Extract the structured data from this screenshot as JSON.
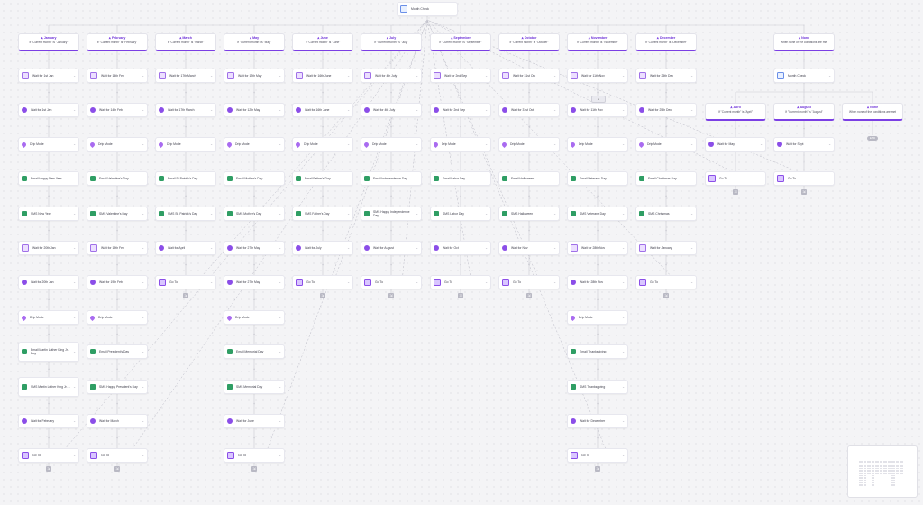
{
  "top_node": {
    "label": "Month Check",
    "icon": "code-icon"
  },
  "columns": [
    {
      "id": "january",
      "title": "January",
      "condition": "If \"Current month\" is \"January\"",
      "steps": [
        {
          "type": "wait-date",
          "label": "Wait for 1st Jan"
        },
        {
          "type": "wait-time",
          "label": "Wait for 1st Jan"
        },
        {
          "type": "drip",
          "label": "Drip Mode"
        },
        {
          "type": "email",
          "label": "Email Happy New Year"
        },
        {
          "type": "sms",
          "label": "SMS New Year"
        },
        {
          "type": "wait-date",
          "label": "Wait for 20th Jan"
        },
        {
          "type": "wait-time",
          "label": "Wait for 20th Jan"
        },
        {
          "type": "drip",
          "label": "Drip Mode"
        },
        {
          "type": "email",
          "label": "Email Martin Luther King Jr. Day"
        },
        {
          "type": "sms",
          "label": "SMS Martin Luther King Jr. ..."
        },
        {
          "type": "wait-time",
          "label": "Wait for February"
        },
        {
          "type": "goto",
          "label": "Go To"
        }
      ]
    },
    {
      "id": "february",
      "title": "February",
      "condition": "If \"Current month\" is \"February\"",
      "steps": [
        {
          "type": "wait-date",
          "label": "Wait for 14th Feb"
        },
        {
          "type": "wait-time",
          "label": "Wait for 14th Feb"
        },
        {
          "type": "drip",
          "label": "Drip Mode"
        },
        {
          "type": "email",
          "label": "Email Valentine's Day"
        },
        {
          "type": "sms",
          "label": "SMS Valentine's Day"
        },
        {
          "type": "wait-date",
          "label": "Wait for 19th Feb"
        },
        {
          "type": "wait-time",
          "label": "Wait for 19th Feb"
        },
        {
          "type": "drip",
          "label": "Drip Mode"
        },
        {
          "type": "email",
          "label": "Email President's Day"
        },
        {
          "type": "sms",
          "label": "SMS Happy President's Day"
        },
        {
          "type": "wait-time",
          "label": "Wait for March"
        },
        {
          "type": "goto",
          "label": "Go To"
        }
      ]
    },
    {
      "id": "march",
      "title": "March",
      "condition": "If \"Current month\" is \"March\"",
      "steps": [
        {
          "type": "wait-date",
          "label": "Wait for 17th March"
        },
        {
          "type": "wait-time",
          "label": "Wait for 17th March"
        },
        {
          "type": "drip",
          "label": "Drip Mode"
        },
        {
          "type": "email",
          "label": "Email St Patrick's Day"
        },
        {
          "type": "sms",
          "label": "SMS St. Patrick's Day"
        },
        {
          "type": "wait-time",
          "label": "Wait for April"
        },
        {
          "type": "goto",
          "label": "Go To"
        }
      ]
    },
    {
      "id": "may",
      "title": "May",
      "condition": "If \"Current month\" is \"May\"",
      "steps": [
        {
          "type": "wait-date",
          "label": "Wait for 12th May"
        },
        {
          "type": "wait-time",
          "label": "Wait for 12th May"
        },
        {
          "type": "drip",
          "label": "Drip Mode"
        },
        {
          "type": "email",
          "label": "Email Mother's Day"
        },
        {
          "type": "sms",
          "label": "SMS Mother's Day"
        },
        {
          "type": "wait-time",
          "label": "Wait for 27th May"
        },
        {
          "type": "wait-time",
          "label": "Wait for 27th May"
        },
        {
          "type": "drip",
          "label": "Drip Mode"
        },
        {
          "type": "email",
          "label": "Email Memorial Day"
        },
        {
          "type": "sms",
          "label": "SMS Memorial Day"
        },
        {
          "type": "wait-time",
          "label": "Wait for June"
        },
        {
          "type": "goto",
          "label": "Go To"
        }
      ]
    },
    {
      "id": "june",
      "title": "June",
      "condition": "If \"Current month\" is \"June\"",
      "steps": [
        {
          "type": "wait-date",
          "label": "Wait for 16th June"
        },
        {
          "type": "wait-time",
          "label": "Wait for 16th June"
        },
        {
          "type": "drip",
          "label": "Drip Mode"
        },
        {
          "type": "email",
          "label": "Email Father's Day"
        },
        {
          "type": "sms",
          "label": "SMS Father's Day"
        },
        {
          "type": "wait-time",
          "label": "Wait for July"
        },
        {
          "type": "goto",
          "label": "Go To"
        }
      ]
    },
    {
      "id": "july",
      "title": "July",
      "condition": "If \"Current month\" is \"July\"",
      "steps": [
        {
          "type": "wait-date",
          "label": "Wait for 4th July"
        },
        {
          "type": "wait-time",
          "label": "Wait for 4th July"
        },
        {
          "type": "drip",
          "label": "Drip Mode"
        },
        {
          "type": "email",
          "label": "Email Independence Day"
        },
        {
          "type": "sms",
          "label": "SMS Happy Independence Day"
        },
        {
          "type": "wait-time",
          "label": "Wait for August"
        },
        {
          "type": "goto",
          "label": "Go To"
        }
      ]
    },
    {
      "id": "september",
      "title": "September",
      "condition": "If \"Current month\" is \"September\"",
      "steps": [
        {
          "type": "wait-date",
          "label": "Wait for 2nd Sep"
        },
        {
          "type": "wait-time",
          "label": "Wait for 2nd Sep"
        },
        {
          "type": "drip",
          "label": "Drip Mode"
        },
        {
          "type": "email",
          "label": "Email Labor Day"
        },
        {
          "type": "sms",
          "label": "SMS Labor Day"
        },
        {
          "type": "wait-time",
          "label": "Wait for Oct"
        },
        {
          "type": "goto",
          "label": "Go To"
        }
      ]
    },
    {
      "id": "october",
      "title": "October",
      "condition": "If \"Current month\" is \"October\"",
      "steps": [
        {
          "type": "wait-date",
          "label": "Wait for 31st Oct"
        },
        {
          "type": "wait-time",
          "label": "Wait for 31st Oct"
        },
        {
          "type": "drip",
          "label": "Drip Mode"
        },
        {
          "type": "email",
          "label": "Email Halloween"
        },
        {
          "type": "sms",
          "label": "SMS Halloween"
        },
        {
          "type": "wait-time",
          "label": "Wait for Nov"
        },
        {
          "type": "goto",
          "label": "Go To"
        }
      ]
    },
    {
      "id": "november",
      "title": "November",
      "condition": "If \"Current month\" is \"November\"",
      "steps": [
        {
          "type": "wait-date",
          "label": "Wait for 11th Nov"
        },
        {
          "type": "wait-time",
          "label": "Wait for 11th Nov"
        },
        {
          "type": "drip",
          "label": "Drip Mode"
        },
        {
          "type": "email",
          "label": "Email Veterans Day"
        },
        {
          "type": "sms",
          "label": "SMS Veterans Day"
        },
        {
          "type": "wait-date",
          "label": "Wait for 28th Nov"
        },
        {
          "type": "wait-time",
          "label": "Wait for 28th Nov"
        },
        {
          "type": "drip",
          "label": "Drip Mode"
        },
        {
          "type": "email",
          "label": "Email Thanksgiving"
        },
        {
          "type": "sms",
          "label": "SMS Thanksgiving"
        },
        {
          "type": "wait-time",
          "label": "Wait for December"
        },
        {
          "type": "goto",
          "label": "Go To"
        }
      ]
    },
    {
      "id": "december",
      "title": "December",
      "condition": "If \"Current month\" is \"December\"",
      "steps": [
        {
          "type": "wait-date",
          "label": "Wait for 25th Dec"
        },
        {
          "type": "wait-time",
          "label": "Wait for 25th Dec"
        },
        {
          "type": "drip",
          "label": "Drip Mode"
        },
        {
          "type": "email",
          "label": "Email Christmas Day"
        },
        {
          "type": "sms",
          "label": "SMS Christmas"
        },
        {
          "type": "wait-date",
          "label": "Wait for January"
        },
        {
          "type": "goto",
          "label": "Go To"
        }
      ]
    },
    {
      "id": "none",
      "title": "None",
      "condition": "When none of the conditions are met",
      "steps": [
        {
          "type": "code",
          "label": "Month Check"
        }
      ]
    }
  ],
  "sub_branches": [
    {
      "id": "april",
      "title": "April",
      "condition": "If \"Current month\" is \"April\"",
      "steps": [
        {
          "type": "wait-time",
          "label": "Wait for May"
        },
        {
          "type": "goto",
          "label": "Go To"
        }
      ]
    },
    {
      "id": "august",
      "title": "August",
      "condition": "If \"Current month\" is \"August\"",
      "steps": [
        {
          "type": "wait-time",
          "label": "Wait for Sept"
        },
        {
          "type": "goto",
          "label": "Go To"
        }
      ]
    },
    {
      "id": "none2",
      "title": "None",
      "condition": "When none of the conditions are met",
      "steps": []
    }
  ],
  "end_label": "END",
  "counter_label": "2",
  "colors": {
    "accent": "#7b3fe4",
    "email": "#2f9e64",
    "edge": "#c9c9d2"
  }
}
